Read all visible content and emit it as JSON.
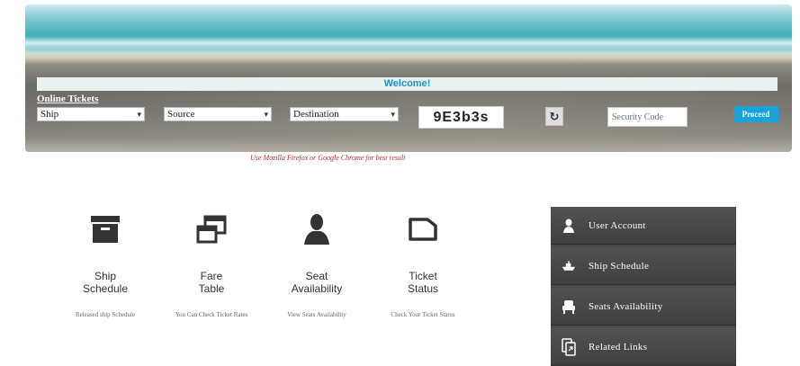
{
  "banner": {
    "welcome": "Welcome!",
    "online_title": "Online Tickets",
    "ship_select": "Ship",
    "source_select": "Source",
    "destination_select": "Destination",
    "captcha_code": "9E3b3s",
    "refresh_icon": "refresh-icon",
    "security_placeholder": "Security Code",
    "proceed_label": "Proceed"
  },
  "hint_text": "Use Mozilla Firefox or Google Chrome for best result",
  "features": [
    {
      "icon": "archive-box-icon",
      "title_line1": "Ship",
      "title_line2": "Schedule",
      "desc": "Released ship Schedule"
    },
    {
      "icon": "windows-icon",
      "title_line1": "Fare",
      "title_line2": "Table",
      "desc": "You Can Check Ticket Rates"
    },
    {
      "icon": "user-icon",
      "title_line1": "Seat",
      "title_line2": "Availability",
      "desc": "View Seats Availability"
    },
    {
      "icon": "folder-icon",
      "title_line1": "Ticket",
      "title_line2": "Status",
      "desc": "Check Your Ticket Status"
    }
  ],
  "sidebar": {
    "items": [
      {
        "icon": "user-icon",
        "label": "User Account"
      },
      {
        "icon": "ship-icon",
        "label": "Ship Schedule"
      },
      {
        "icon": "seat-icon",
        "label": "Seats Availability"
      },
      {
        "icon": "link-icon",
        "label": "Related Links"
      }
    ]
  },
  "colors": {
    "accent": "#1aa3da",
    "hint": "#c1272d",
    "sidebar": "#4a4a4a"
  }
}
